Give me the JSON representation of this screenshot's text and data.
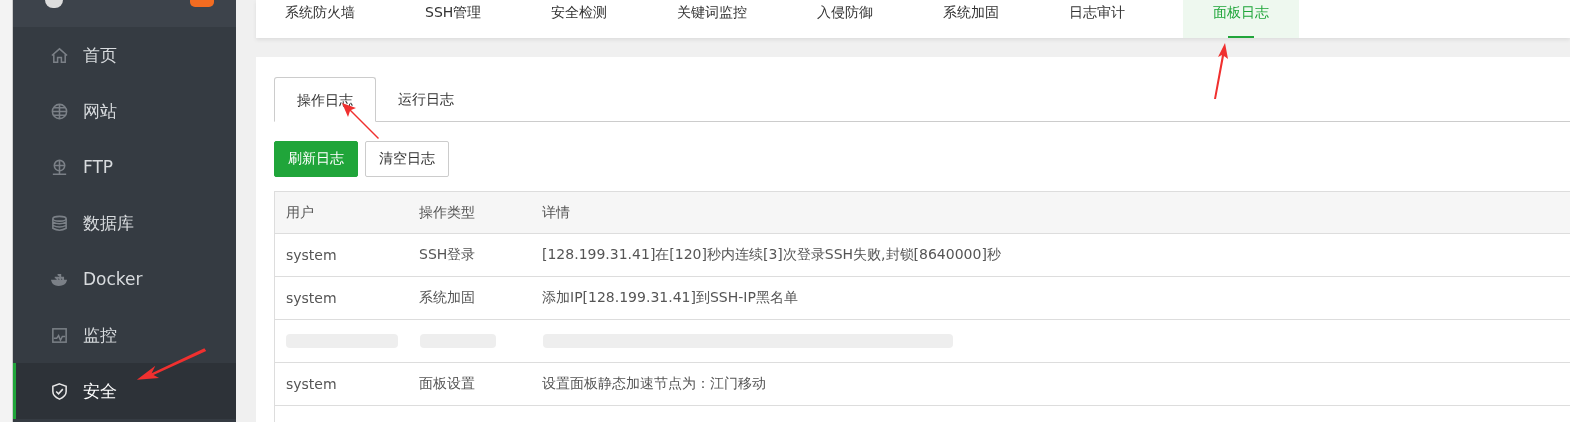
{
  "sidebar": {
    "items": [
      {
        "label": "首页",
        "selected": false
      },
      {
        "label": "网站",
        "selected": false
      },
      {
        "label": "FTP",
        "selected": false
      },
      {
        "label": "数据库",
        "selected": false
      },
      {
        "label": "Docker",
        "selected": false
      },
      {
        "label": "监控",
        "selected": false
      },
      {
        "label": "安全",
        "selected": true
      }
    ]
  },
  "top_tabs": [
    {
      "label": "系统防火墙",
      "selected": false
    },
    {
      "label": "SSH管理",
      "selected": false
    },
    {
      "label": "安全检测",
      "selected": false
    },
    {
      "label": "关键词监控",
      "selected": false
    },
    {
      "label": "入侵防御",
      "selected": false
    },
    {
      "label": "系统加固",
      "selected": false
    },
    {
      "label": "日志审计",
      "selected": false
    },
    {
      "label": "面板日志",
      "selected": true
    }
  ],
  "sub_tabs": [
    {
      "label": "操作日志",
      "selected": true
    },
    {
      "label": "运行日志",
      "selected": false
    }
  ],
  "buttons": [
    {
      "label": "刷新日志",
      "kind": "primary"
    },
    {
      "label": "清空日志",
      "kind": "default"
    }
  ],
  "table": {
    "columns": [
      "用户",
      "操作类型",
      "详情"
    ],
    "rows": [
      {
        "redacted": false,
        "cells": [
          "system",
          "SSH登录",
          "[128.199.31.41]在[120]秒内连续[3]次登录SSH失败,封锁[8640000]秒"
        ]
      },
      {
        "redacted": false,
        "cells": [
          "system",
          "系统加固",
          "添加IP[128.199.31.41]到SSH-IP黑名单"
        ]
      },
      {
        "redacted": true,
        "cells": []
      },
      {
        "redacted": false,
        "cells": [
          "system",
          "面板设置",
          "设置面板静态加速节点为：江门移动"
        ]
      }
    ]
  }
}
